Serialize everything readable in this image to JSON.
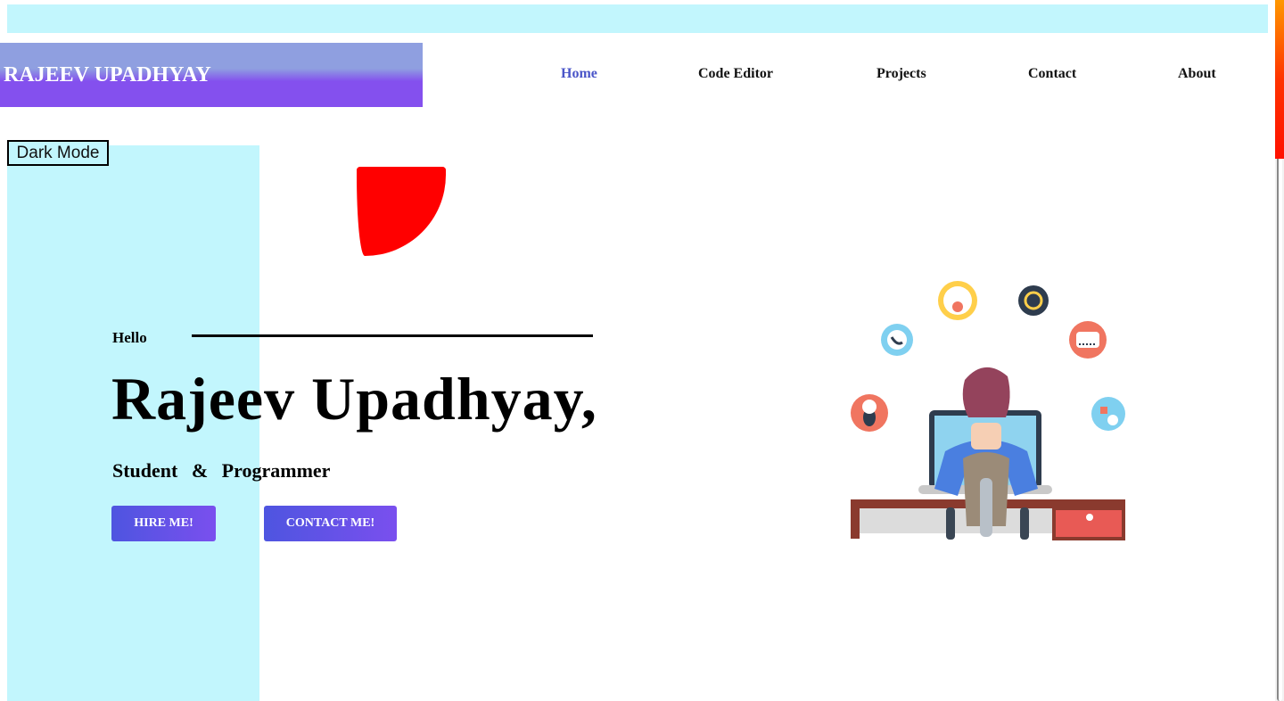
{
  "header": {
    "brand": "RAJEEV UPADHYAY",
    "nav": [
      "Home",
      "Code Editor",
      "Projects",
      "Contact",
      "About"
    ]
  },
  "controls": {
    "dark_mode_label": "Dark Mode"
  },
  "hero": {
    "greeting": "Hello",
    "name": "Rajeev Upadhyay,",
    "subtitle": "Student & Programmer",
    "hire_button": "HIRE ME!",
    "contact_button": "CONTACT ME!"
  },
  "colors": {
    "top_bar": "#c2f6fd",
    "side_panel": "#c2f6fd",
    "nav_active": "#4a55c8",
    "button_gradient_start": "#4e55e0",
    "button_gradient_end": "#7a4fee",
    "blob": "#ff0000"
  },
  "icons": [
    "cloud-settings-icon",
    "sync-icon",
    "phone-icon",
    "server-icon",
    "mouse-icon",
    "cloud-network-icon"
  ]
}
